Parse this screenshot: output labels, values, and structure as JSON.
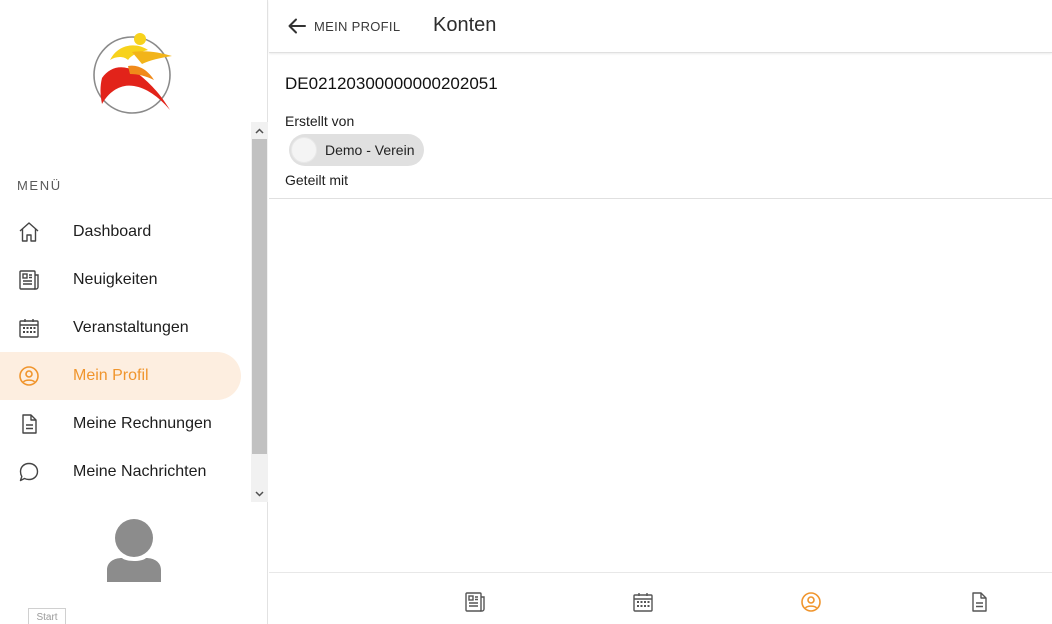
{
  "sidebar": {
    "menu_heading": "MENÜ",
    "items": [
      {
        "label": "Dashboard",
        "icon": "home-icon",
        "active": false
      },
      {
        "label": "Neuigkeiten",
        "icon": "newspaper-icon",
        "active": false
      },
      {
        "label": "Veranstaltungen",
        "icon": "calendar-icon",
        "active": false
      },
      {
        "label": "Mein Profil",
        "icon": "account-circle-icon",
        "active": true
      },
      {
        "label": "Meine Rechnungen",
        "icon": "document-icon",
        "active": false
      },
      {
        "label": "Meine Nachrichten",
        "icon": "chat-bubble-icon",
        "active": false
      }
    ],
    "start_tab": "Start"
  },
  "header": {
    "back_label": "MEIN PROFIL",
    "title": "Konten"
  },
  "account": {
    "iban": "DE02120300000000202051",
    "created_by_label": "Erstellt von",
    "created_by_name": "Demo - Verein",
    "shared_with_label": "Geteilt mit"
  },
  "bottom_nav": {
    "items": [
      {
        "icon": "newspaper-icon",
        "active": false
      },
      {
        "icon": "calendar-icon",
        "active": false
      },
      {
        "icon": "account-circle-icon",
        "active": true
      },
      {
        "icon": "document-icon",
        "active": false
      }
    ]
  },
  "colors": {
    "accent": "#f0952d",
    "active_bg": "#fdeee0"
  }
}
